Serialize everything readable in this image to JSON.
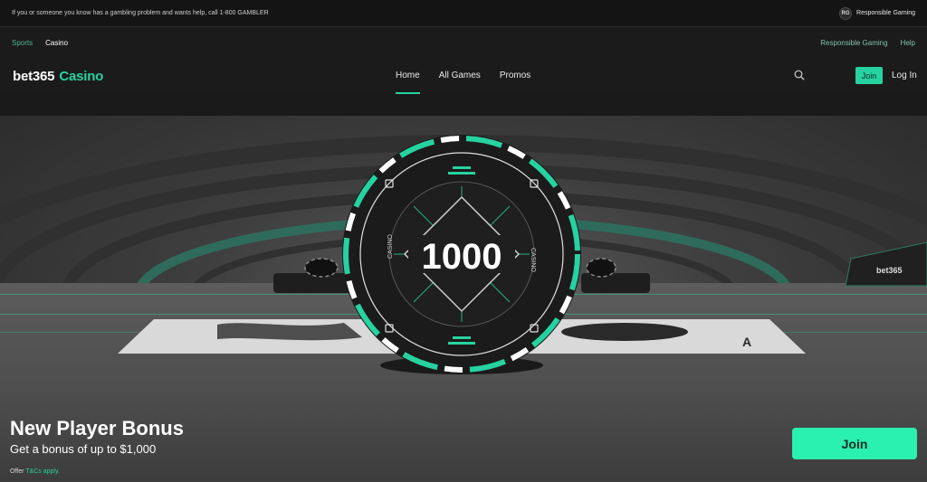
{
  "topbar": {
    "message": "If you or someone you know has a gambling problem and wants help, call 1-800 GAMBLER",
    "rg_badge": "RG",
    "rg_label": "Responsible Gaming"
  },
  "subnav": {
    "left": [
      "Sports",
      "Casino"
    ],
    "right": [
      "Responsible Gaming",
      "Help"
    ]
  },
  "mainnav": {
    "brand_primary": "bet365",
    "brand_secondary": "Casino",
    "links": [
      "Home",
      "All Games",
      "Promos"
    ],
    "active": "Home",
    "join_label": "Join",
    "login_label": "Log In",
    "accent": "#26d3a0"
  },
  "hero": {
    "chip_value": "1000",
    "chip_text": "CASINO",
    "bonus_title": "New Player Bonus",
    "bonus_subtitle": "Get a bonus of up to $1,000",
    "offer_prefix": "Offer",
    "offer_link": "T&Cs apply.",
    "join_label": "Join"
  }
}
